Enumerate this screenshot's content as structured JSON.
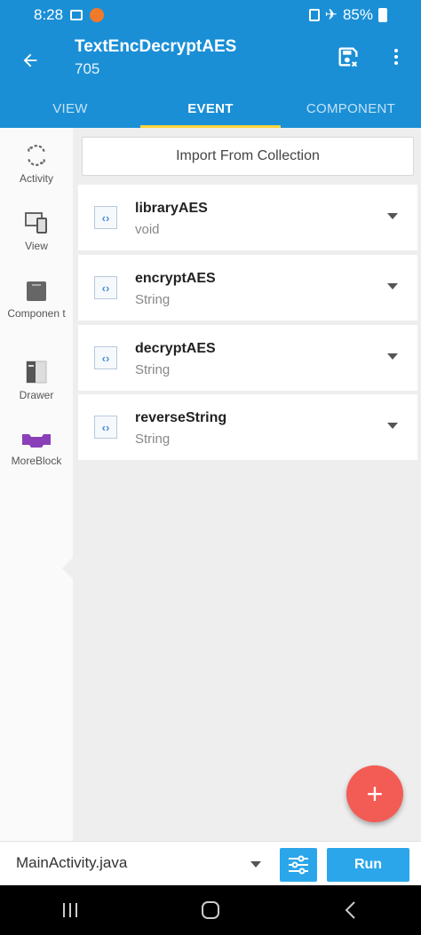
{
  "status_bar": {
    "time": "8:28",
    "battery": "85%"
  },
  "app_bar": {
    "title": "TextEncDecryptAES",
    "subtitle": "705"
  },
  "tabs": [
    {
      "label": "VIEW",
      "active": false
    },
    {
      "label": "EVENT",
      "active": true
    },
    {
      "label": "COMPONENT",
      "active": false
    }
  ],
  "sidebar": {
    "items": [
      {
        "label": "Activity",
        "icon": "refresh-icon"
      },
      {
        "label": "View",
        "icon": "devices-icon"
      },
      {
        "label": "Componen t",
        "icon": "component-icon"
      },
      {
        "label": "Drawer",
        "icon": "drawer-icon"
      },
      {
        "label": "MoreBlock",
        "icon": "moreblock-icon",
        "selected": true
      }
    ]
  },
  "main": {
    "import_label": "Import From Collection",
    "blocks": [
      {
        "name": "libraryAES",
        "type": "void"
      },
      {
        "name": "encryptAES",
        "type": "String"
      },
      {
        "name": "decryptAES",
        "type": "String"
      },
      {
        "name": "reverseString",
        "type": "String"
      }
    ]
  },
  "fab": {
    "label": "+"
  },
  "bottom_bar": {
    "file": "MainActivity.java",
    "run_label": "Run"
  },
  "colors": {
    "primary": "#1a8fd6",
    "accent": "#ffd43b",
    "fab": "#f25c54",
    "button": "#2ba6ea",
    "moreblock": "#8a3fb8"
  }
}
